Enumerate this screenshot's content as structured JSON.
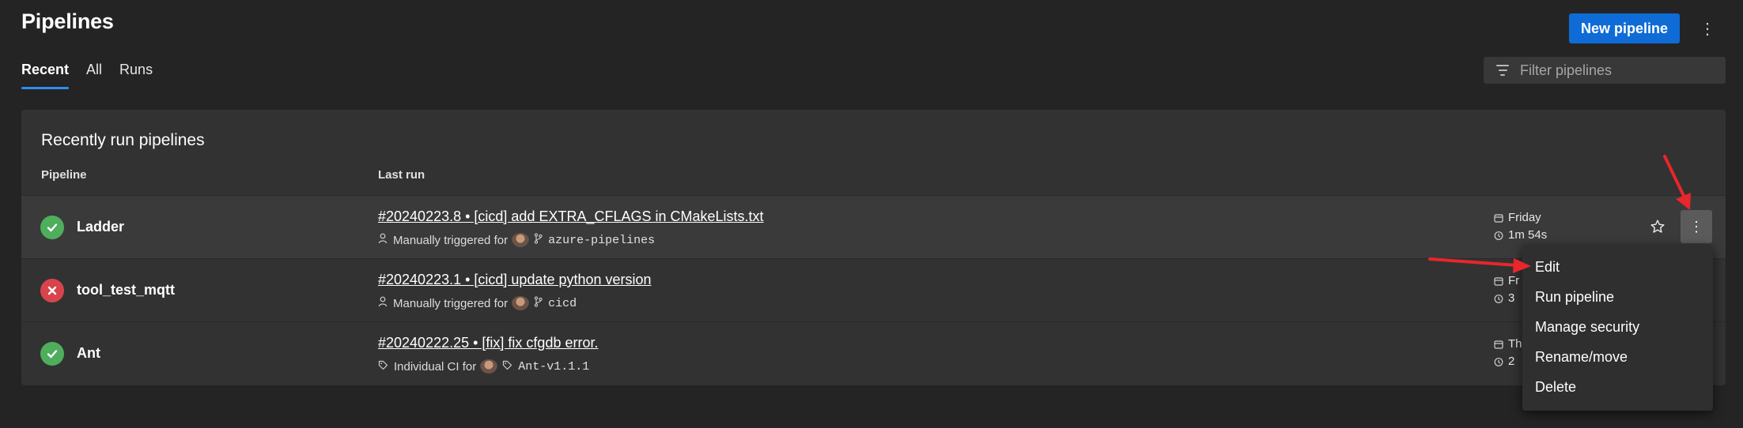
{
  "header": {
    "title": "Pipelines",
    "new_pipeline_label": "New pipeline",
    "more_icon": "⋮"
  },
  "tabs": [
    {
      "label": "Recent",
      "active": true
    },
    {
      "label": "All",
      "active": false
    },
    {
      "label": "Runs",
      "active": false
    }
  ],
  "filter": {
    "placeholder": "Filter pipelines"
  },
  "card": {
    "title": "Recently run pipelines",
    "col_pipeline": "Pipeline",
    "col_last_run": "Last run"
  },
  "rows": [
    {
      "status": "succeeded",
      "name": "Ladder",
      "run_title": "#20240223.8 • [cicd] add EXTRA_CFLAGS in CMakeLists.txt",
      "trigger_text": "Manually triggered for",
      "ref": "azure-pipelines",
      "date": "Friday",
      "duration": "1m 54s"
    },
    {
      "status": "failed",
      "name": "tool_test_mqtt",
      "run_title": "#20240223.1 • [cicd] update python version",
      "trigger_text": "Manually triggered for",
      "ref": "cicd",
      "date": "Fr",
      "duration": "3"
    },
    {
      "status": "succeeded",
      "name": "Ant",
      "run_title": "#20240222.25 • [fix] fix cfgdb error.",
      "trigger_text": "Individual CI for",
      "ref": "Ant-v1.1.1",
      "date": "Th",
      "duration": "2"
    }
  ],
  "context_menu": {
    "items": [
      "Edit",
      "Run pipeline",
      "Manage security",
      "Rename/move",
      "Delete"
    ]
  },
  "colors": {
    "accent": "#0f6cd6",
    "success": "#4fae5c",
    "failure": "#d9444c",
    "annotation_arrow": "#e8262b"
  }
}
